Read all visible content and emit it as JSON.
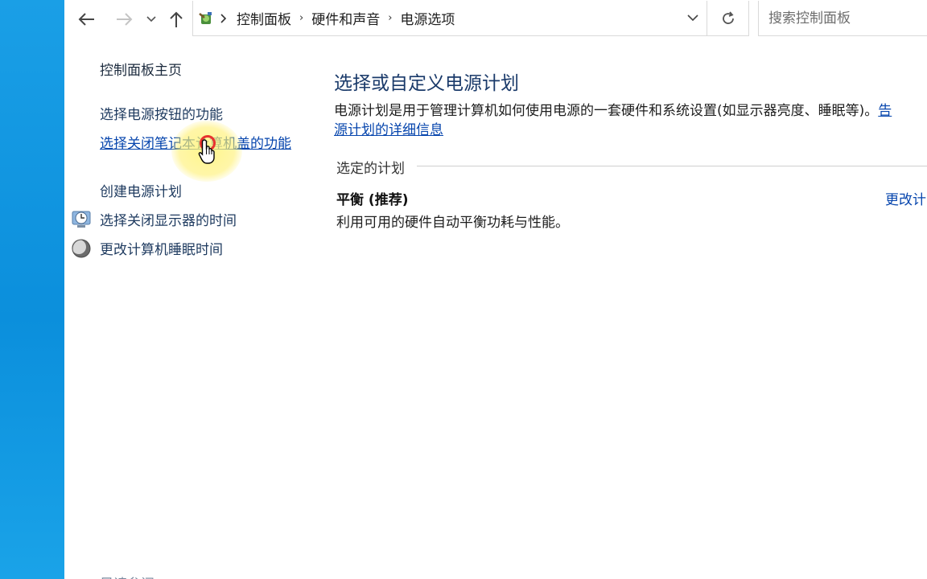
{
  "address_bar": {
    "breadcrumbs": [
      "控制面板",
      "硬件和声音",
      "电源选项"
    ]
  },
  "search": {
    "placeholder": "搜索控制面板"
  },
  "sidebar": {
    "home": "控制面板主页",
    "items": [
      {
        "label": "选择电源按钮的功能"
      },
      {
        "label": "选择关闭笔记本计算机盖的功能"
      },
      {
        "label": "创建电源计划"
      },
      {
        "label": "选择关闭显示器的时间"
      },
      {
        "label": "更改计算机睡眠时间"
      }
    ],
    "bottom_partial": "另请参阅"
  },
  "main": {
    "title": "选择或自定义电源计划",
    "description": "电源计划是用于管理计算机如何使用电源的一套硬件和系统设置(如显示器亮度、睡眠等)。",
    "description_link_part1": "告",
    "description_link_part2": "源计划的详细信息",
    "section_label": "选定的计划",
    "plan": {
      "name": "平衡 (推荐)",
      "description": "利用可用的硬件自动平衡功耗与性能。",
      "change_link": "更改计"
    }
  },
  "colors": {
    "link": "#0645ad",
    "title": "#1a3a6a",
    "desktop": "#0b8fdc"
  }
}
